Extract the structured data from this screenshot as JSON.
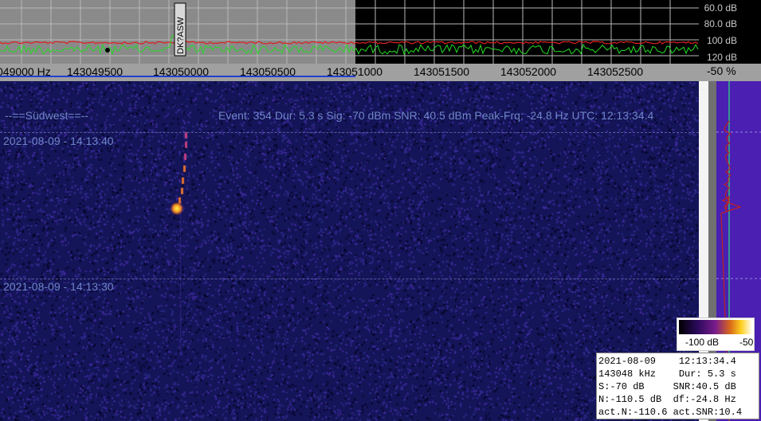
{
  "spectrum": {
    "db_labels": [
      "60.0 dB",
      "80.0 dB",
      "100 dB",
      "120 dB"
    ],
    "marker_label": "DK?ASW"
  },
  "freq_axis": {
    "labels": [
      "049000 Hz",
      "143049500",
      "143050000",
      "143050500",
      "143051000",
      "143051500",
      "143052000",
      "143052500"
    ]
  },
  "pct_box": {
    "label": "-50 %"
  },
  "waterfall": {
    "station": "--==Südwest==--",
    "event_info": "Event: 354   Dur: 5.3 s   Sig: -70 dBm   SNR: 40.5 dBm   Peak-Frq: -24.8 Hz   UTC: 12:13:34.4",
    "timestamps": [
      "2021-08-09 - 14:13:40",
      "2021-08-09 - 14:13:30"
    ]
  },
  "color_scale": {
    "min_label": "-100 dB",
    "max_label": "-50"
  },
  "info_box": {
    "lines": [
      "2021-08-09    12:13:34.4",
      "143048 kHz    Dur: 5.3 s",
      "S:-70 dB     SNR:40.5 dB",
      "N:-110.5 dB  df:-24.8 Hz",
      "act.N:-110.6 act.SNR:10.4"
    ]
  },
  "colors": {
    "waterfall_bg": "#141458",
    "spectrum_noise": "#22dd22",
    "spectrum_avg": "#e02020",
    "level_panel": "#4a1fb2"
  }
}
